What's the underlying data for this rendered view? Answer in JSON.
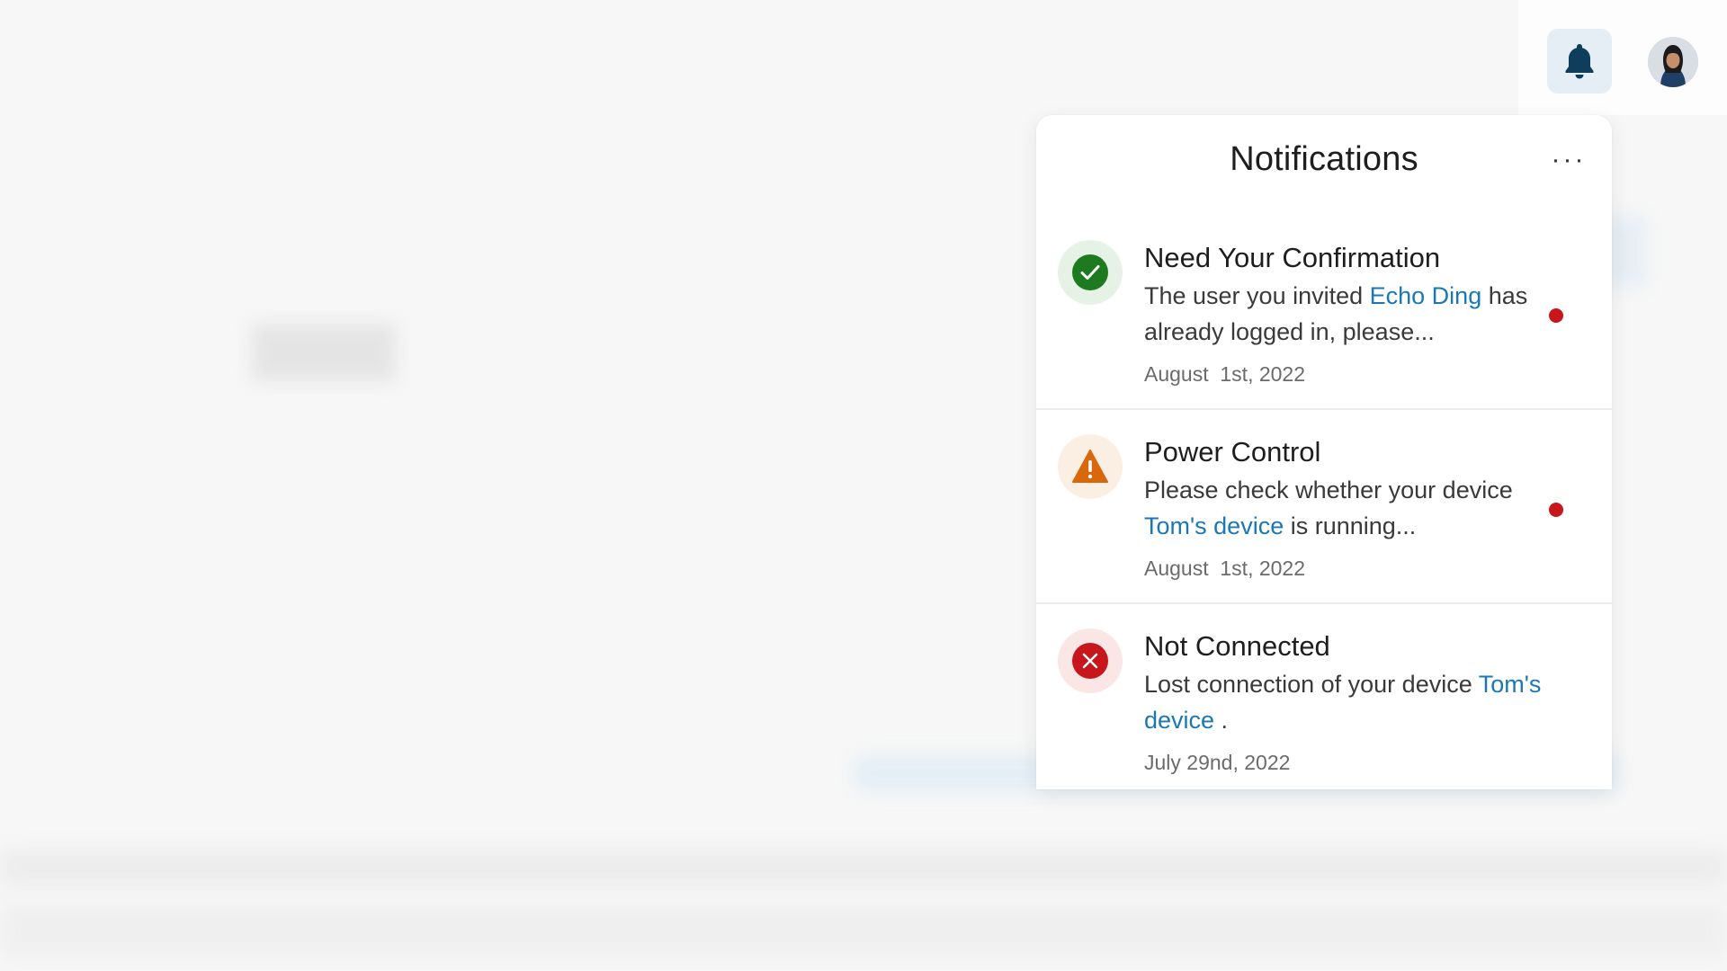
{
  "colors": {
    "accent": "#1a78b4",
    "success": "#1e7a1e",
    "warning": "#d9670c",
    "error": "#c8161d",
    "unread_dot": "#c8161d"
  },
  "header": {
    "notification_icon": "bell-icon",
    "avatar_icon": "user-avatar"
  },
  "notifications_panel": {
    "title": "Notifications",
    "more_label": "···",
    "items": [
      {
        "type": "success",
        "icon": "check-circle-icon",
        "title": "Need Your Confirmation",
        "body_pre": "The user you invited ",
        "body_link": "Echo Ding",
        "body_post": " has already logged in, please...",
        "date": "August  1st, 2022",
        "unread": true
      },
      {
        "type": "warning",
        "icon": "warning-triangle-icon",
        "title": "Power Control",
        "body_pre": "Please check whether your device ",
        "body_link": "Tom's device",
        "body_post": " is running...",
        "date": "August  1st, 2022",
        "unread": true
      },
      {
        "type": "error",
        "icon": "error-circle-icon",
        "title": "Not Connected",
        "body_pre": "Lost connection of your device ",
        "body_link": "Tom's device",
        "body_post": " .",
        "date": "July 29nd, 2022",
        "unread": false
      }
    ]
  }
}
